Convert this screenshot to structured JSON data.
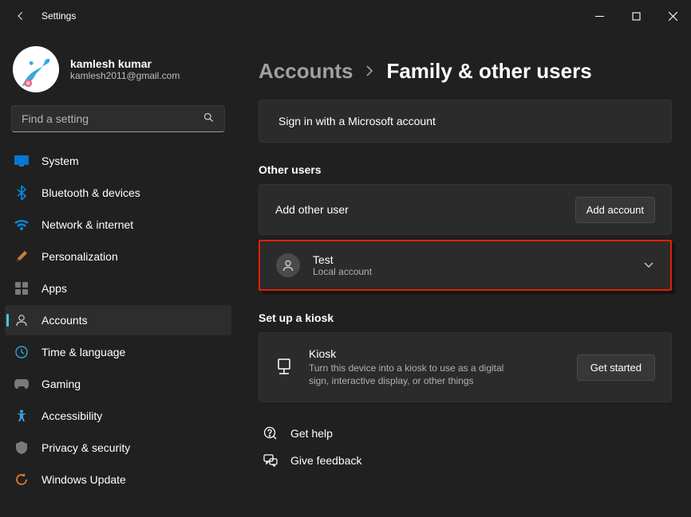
{
  "window": {
    "title": "Settings"
  },
  "profile": {
    "name": "kamlesh kumar",
    "email": "kamlesh2011@gmail.com"
  },
  "search": {
    "placeholder": "Find a setting"
  },
  "nav": {
    "system": "System",
    "bluetooth": "Bluetooth & devices",
    "network": "Network & internet",
    "personalization": "Personalization",
    "apps": "Apps",
    "accounts": "Accounts",
    "time": "Time & language",
    "gaming": "Gaming",
    "accessibility": "Accessibility",
    "privacy": "Privacy & security",
    "update": "Windows Update"
  },
  "breadcrumb": {
    "parent": "Accounts",
    "current": "Family & other users"
  },
  "signin_card": "Sign in with a Microsoft account",
  "other_users": {
    "section_title": "Other users",
    "add_other_label": "Add other user",
    "add_account_btn": "Add account",
    "user_name": "Test",
    "user_type": "Local account"
  },
  "kiosk": {
    "section_title": "Set up a kiosk",
    "title": "Kiosk",
    "desc": "Turn this device into a kiosk to use as a digital sign, interactive display, or other things",
    "btn": "Get started"
  },
  "footer": {
    "help": "Get help",
    "feedback": "Give feedback"
  }
}
